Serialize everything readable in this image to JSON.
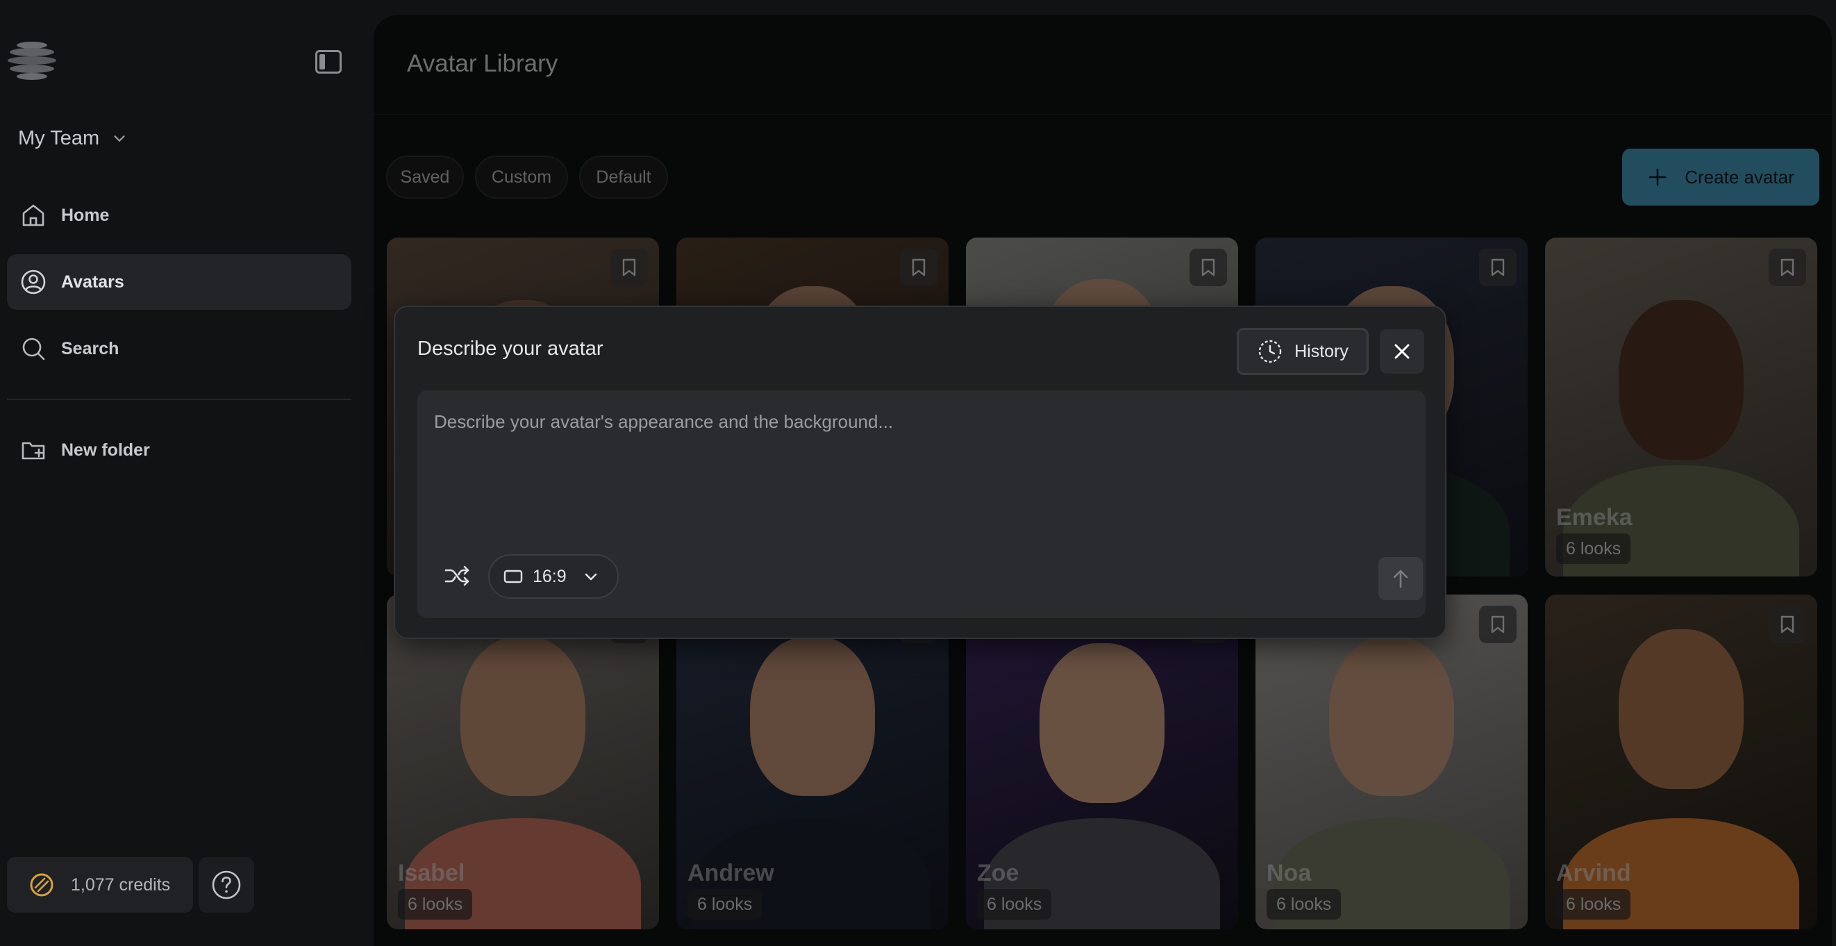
{
  "sidebar": {
    "team_name": "My Team",
    "nav": [
      {
        "label": "Home",
        "icon": "home-icon",
        "active": false
      },
      {
        "label": "Avatars",
        "icon": "user-circle-icon",
        "active": true
      },
      {
        "label": "Search",
        "icon": "search-icon",
        "active": false
      },
      {
        "label": "New folder",
        "icon": "folder-plus-icon",
        "active": false
      }
    ],
    "credits": "1,077 credits"
  },
  "main": {
    "title": "Avatar Library",
    "filters": [
      "Saved",
      "Custom",
      "Default"
    ],
    "create_label": "Create avatar"
  },
  "avatars": [
    {
      "name": "",
      "looks": ""
    },
    {
      "name": "",
      "looks": ""
    },
    {
      "name": "",
      "looks": ""
    },
    {
      "name": "",
      "looks": ""
    },
    {
      "name": "Emeka",
      "looks": "6 looks"
    },
    {
      "name": "Isabel",
      "looks": "6 looks"
    },
    {
      "name": "Andrew",
      "looks": "6 looks"
    },
    {
      "name": "Zoe",
      "looks": "6 looks"
    },
    {
      "name": "Noa",
      "looks": "6 looks"
    },
    {
      "name": "Arvind",
      "looks": "6 looks"
    }
  ],
  "modal": {
    "title": "Describe your avatar",
    "history_label": "History",
    "prompt_placeholder": "Describe your avatar's appearance and the background...",
    "aspect_ratio": "16:9"
  },
  "colors": {
    "accent": "#3f8cab",
    "background": "#111213",
    "panel": "#1f2022"
  }
}
